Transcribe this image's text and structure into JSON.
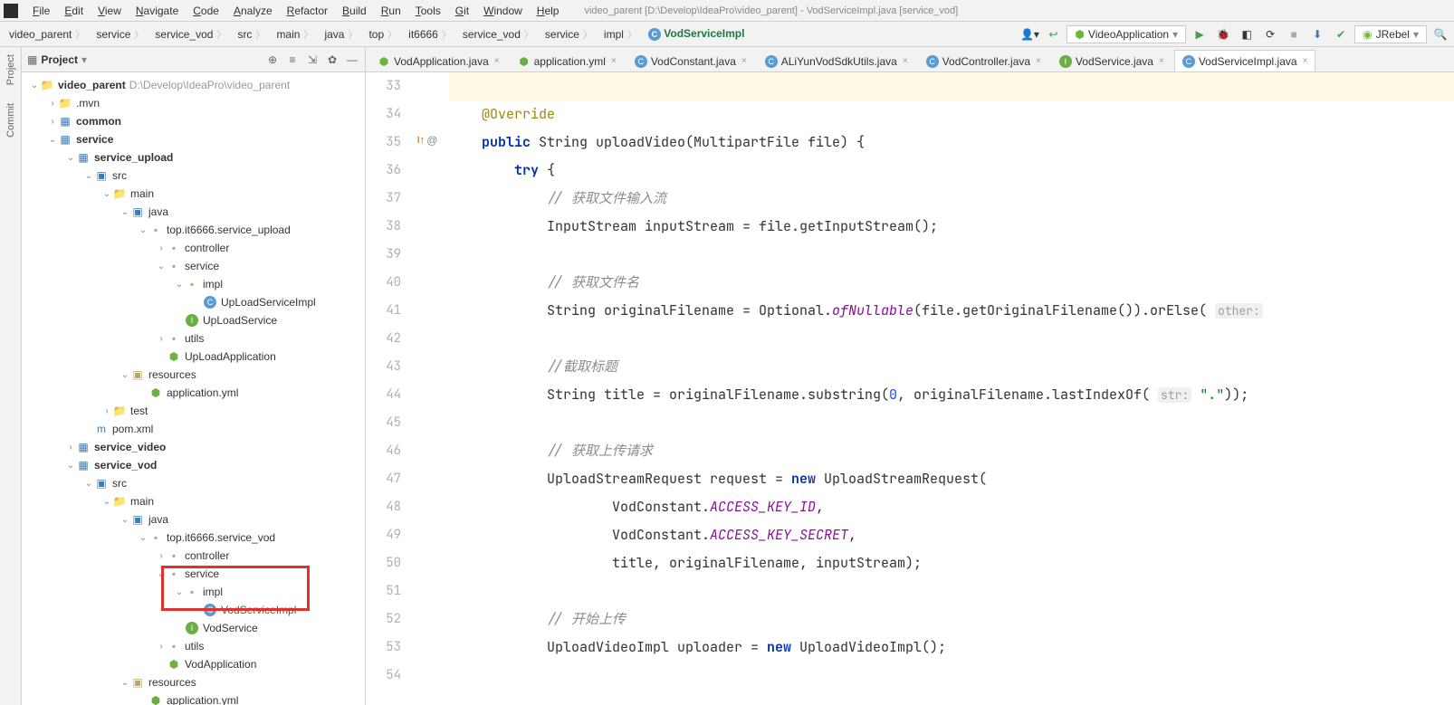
{
  "title": "video_parent [D:\\Develop\\IdeaPro\\video_parent] - VodServiceImpl.java [service_vod]",
  "menu": [
    "File",
    "Edit",
    "View",
    "Navigate",
    "Code",
    "Analyze",
    "Refactor",
    "Build",
    "Run",
    "Tools",
    "Git",
    "Window",
    "Help"
  ],
  "breadcrumbs": [
    "video_parent",
    "service",
    "service_vod",
    "src",
    "main",
    "java",
    "top",
    "it6666",
    "service_vod",
    "service",
    "impl",
    "VodServiceImpl"
  ],
  "runConfig": "VideoApplication",
  "jrebel": "JRebel",
  "leftGutter": [
    "Project",
    "Commit"
  ],
  "projectPanel": {
    "title": "Project"
  },
  "tree": [
    {
      "d": 0,
      "arrow": "v",
      "icon": "folder",
      "label": "video_parent",
      "path": "D:\\Develop\\IdeaPro\\video_parent",
      "bold": true
    },
    {
      "d": 1,
      "arrow": ">",
      "icon": "folder",
      "label": ".mvn"
    },
    {
      "d": 1,
      "arrow": ">",
      "icon": "module",
      "label": "common",
      "bold": true
    },
    {
      "d": 1,
      "arrow": "v",
      "icon": "module",
      "label": "service",
      "bold": true
    },
    {
      "d": 2,
      "arrow": "v",
      "icon": "module",
      "label": "service_upload",
      "bold": true
    },
    {
      "d": 3,
      "arrow": "v",
      "icon": "folder-src",
      "label": "src"
    },
    {
      "d": 4,
      "arrow": "v",
      "icon": "folder",
      "label": "main"
    },
    {
      "d": 5,
      "arrow": "v",
      "icon": "folder-java",
      "label": "java"
    },
    {
      "d": 6,
      "arrow": "v",
      "icon": "package",
      "label": "top.it6666.service_upload"
    },
    {
      "d": 7,
      "arrow": ">",
      "icon": "package",
      "label": "controller"
    },
    {
      "d": 7,
      "arrow": "v",
      "icon": "package",
      "label": "service"
    },
    {
      "d": 8,
      "arrow": "v",
      "icon": "package",
      "label": "impl"
    },
    {
      "d": 9,
      "arrow": "",
      "icon": "class",
      "label": "UpLoadServiceImpl"
    },
    {
      "d": 8,
      "arrow": "",
      "icon": "interface",
      "label": "UpLoadService"
    },
    {
      "d": 7,
      "arrow": ">",
      "icon": "package",
      "label": "utils"
    },
    {
      "d": 7,
      "arrow": "",
      "icon": "spring",
      "label": "UpLoadApplication"
    },
    {
      "d": 5,
      "arrow": "v",
      "icon": "folder-res",
      "label": "resources"
    },
    {
      "d": 6,
      "arrow": "",
      "icon": "yml",
      "label": "application.yml"
    },
    {
      "d": 4,
      "arrow": ">",
      "icon": "folder",
      "label": "test"
    },
    {
      "d": 3,
      "arrow": "",
      "icon": "xml",
      "label": "pom.xml"
    },
    {
      "d": 2,
      "arrow": ">",
      "icon": "module",
      "label": "service_video",
      "bold": true
    },
    {
      "d": 2,
      "arrow": "v",
      "icon": "module",
      "label": "service_vod",
      "bold": true
    },
    {
      "d": 3,
      "arrow": "v",
      "icon": "folder-src",
      "label": "src"
    },
    {
      "d": 4,
      "arrow": "v",
      "icon": "folder",
      "label": "main"
    },
    {
      "d": 5,
      "arrow": "v",
      "icon": "folder-java",
      "label": "java"
    },
    {
      "d": 6,
      "arrow": "v",
      "icon": "package",
      "label": "top.it6666.service_vod"
    },
    {
      "d": 7,
      "arrow": ">",
      "icon": "package",
      "label": "controller"
    },
    {
      "d": 7,
      "arrow": "v",
      "icon": "package",
      "label": "service"
    },
    {
      "d": 8,
      "arrow": "v",
      "icon": "package",
      "label": "impl"
    },
    {
      "d": 9,
      "arrow": "",
      "icon": "class",
      "label": "VodServiceImpl",
      "hl": true
    },
    {
      "d": 8,
      "arrow": "",
      "icon": "interface",
      "label": "VodService"
    },
    {
      "d": 7,
      "arrow": ">",
      "icon": "package",
      "label": "utils"
    },
    {
      "d": 7,
      "arrow": "",
      "icon": "spring",
      "label": "VodApplication"
    },
    {
      "d": 5,
      "arrow": "v",
      "icon": "folder-res",
      "label": "resources"
    },
    {
      "d": 6,
      "arrow": "",
      "icon": "yml",
      "label": "application.yml"
    }
  ],
  "tabs": [
    {
      "icon": "spring",
      "label": "VodApplication.java"
    },
    {
      "icon": "yml",
      "label": "application.yml"
    },
    {
      "icon": "class",
      "label": "VodConstant.java"
    },
    {
      "icon": "class",
      "label": "ALiYunVodSdkUtils.java"
    },
    {
      "icon": "class",
      "label": "VodController.java"
    },
    {
      "icon": "interface",
      "label": "VodService.java"
    },
    {
      "icon": "class",
      "label": "VodServiceImpl.java",
      "active": true
    }
  ],
  "lineStart": 33,
  "code": [
    {
      "hl": true,
      "html": ""
    },
    {
      "html": "    <span class='ann'>@Override</span>"
    },
    {
      "html": "    <span class='kw'>public</span> String uploadVideo(MultipartFile file) {",
      "marker": "impl"
    },
    {
      "html": "        <span class='kw'>try</span> {"
    },
    {
      "html": "            <span class='com'>// 获取文件输入流</span>"
    },
    {
      "html": "            InputStream inputStream = file.getInputStream();"
    },
    {
      "html": ""
    },
    {
      "html": "            <span class='com'>// 获取文件名</span>"
    },
    {
      "html": "            String originalFilename = Optional.<span class='field'>ofNullable</span>(file.getOriginalFilename()).orElse( <span class='hint'>other:</span>"
    },
    {
      "html": ""
    },
    {
      "html": "            <span class='com'>//截取标题</span>"
    },
    {
      "html": "            String title = originalFilename.substring(<span class='num'>0</span>, originalFilename.lastIndexOf( <span class='hint'>str:</span> <span class='str'>\".\"</span>));"
    },
    {
      "html": ""
    },
    {
      "html": "            <span class='com'>// 获取上传请求</span>"
    },
    {
      "html": "            UploadStreamRequest request = <span class='kw'>new</span> UploadStreamRequest("
    },
    {
      "html": "                    VodConstant.<span class='field'>ACCESS_KEY_ID</span>,"
    },
    {
      "html": "                    VodConstant.<span class='field'>ACCESS_KEY_SECRET</span>,"
    },
    {
      "html": "                    title, originalFilename, inputStream);"
    },
    {
      "html": ""
    },
    {
      "html": "            <span class='com'>// 开始上传</span>"
    },
    {
      "html": "            UploadVideoImpl uploader = <span class='kw'>new</span> UploadVideoImpl();"
    },
    {
      "html": ""
    }
  ]
}
